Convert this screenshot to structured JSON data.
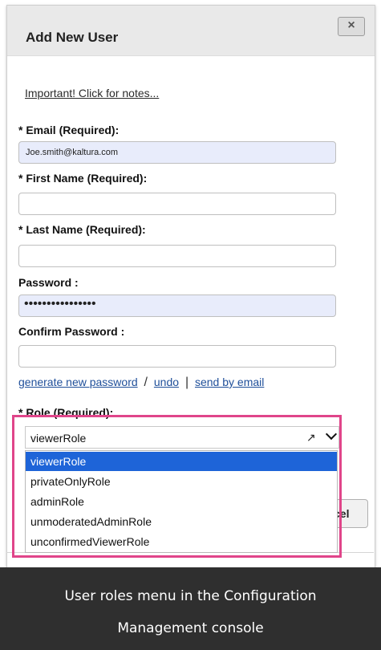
{
  "dialog": {
    "title": "Add New User",
    "close_label": "×",
    "notes_link": "Important! Click for notes...",
    "fields": {
      "email": {
        "label": "* Email (Required):",
        "value": "Joe.smith@kaltura.com"
      },
      "first_name": {
        "label": "* First Name (Required):",
        "value": ""
      },
      "last_name": {
        "label": "* Last Name (Required):",
        "value": ""
      },
      "password": {
        "label": "Password :",
        "value": "••••••••••••••••"
      },
      "confirm_password": {
        "label": "Confirm Password :",
        "value": ""
      }
    },
    "links": {
      "generate": "generate new password",
      "slash": "/",
      "undo": "undo",
      "bar": "|",
      "send": "send by email"
    },
    "role": {
      "label": "* Role (Required):",
      "selected": "viewerRole",
      "options": [
        "viewerRole",
        "privateOnlyRole",
        "adminRole",
        "unmoderatedAdminRole",
        "unconfirmedViewerRole"
      ]
    },
    "cancel_partial": "cel"
  },
  "caption": {
    "line1": "User roles menu in the Configuration",
    "line2": "Management console"
  },
  "colors": {
    "highlight": "#e0458a",
    "selected_option": "#1e64d8",
    "link": "#1f4f9a"
  }
}
